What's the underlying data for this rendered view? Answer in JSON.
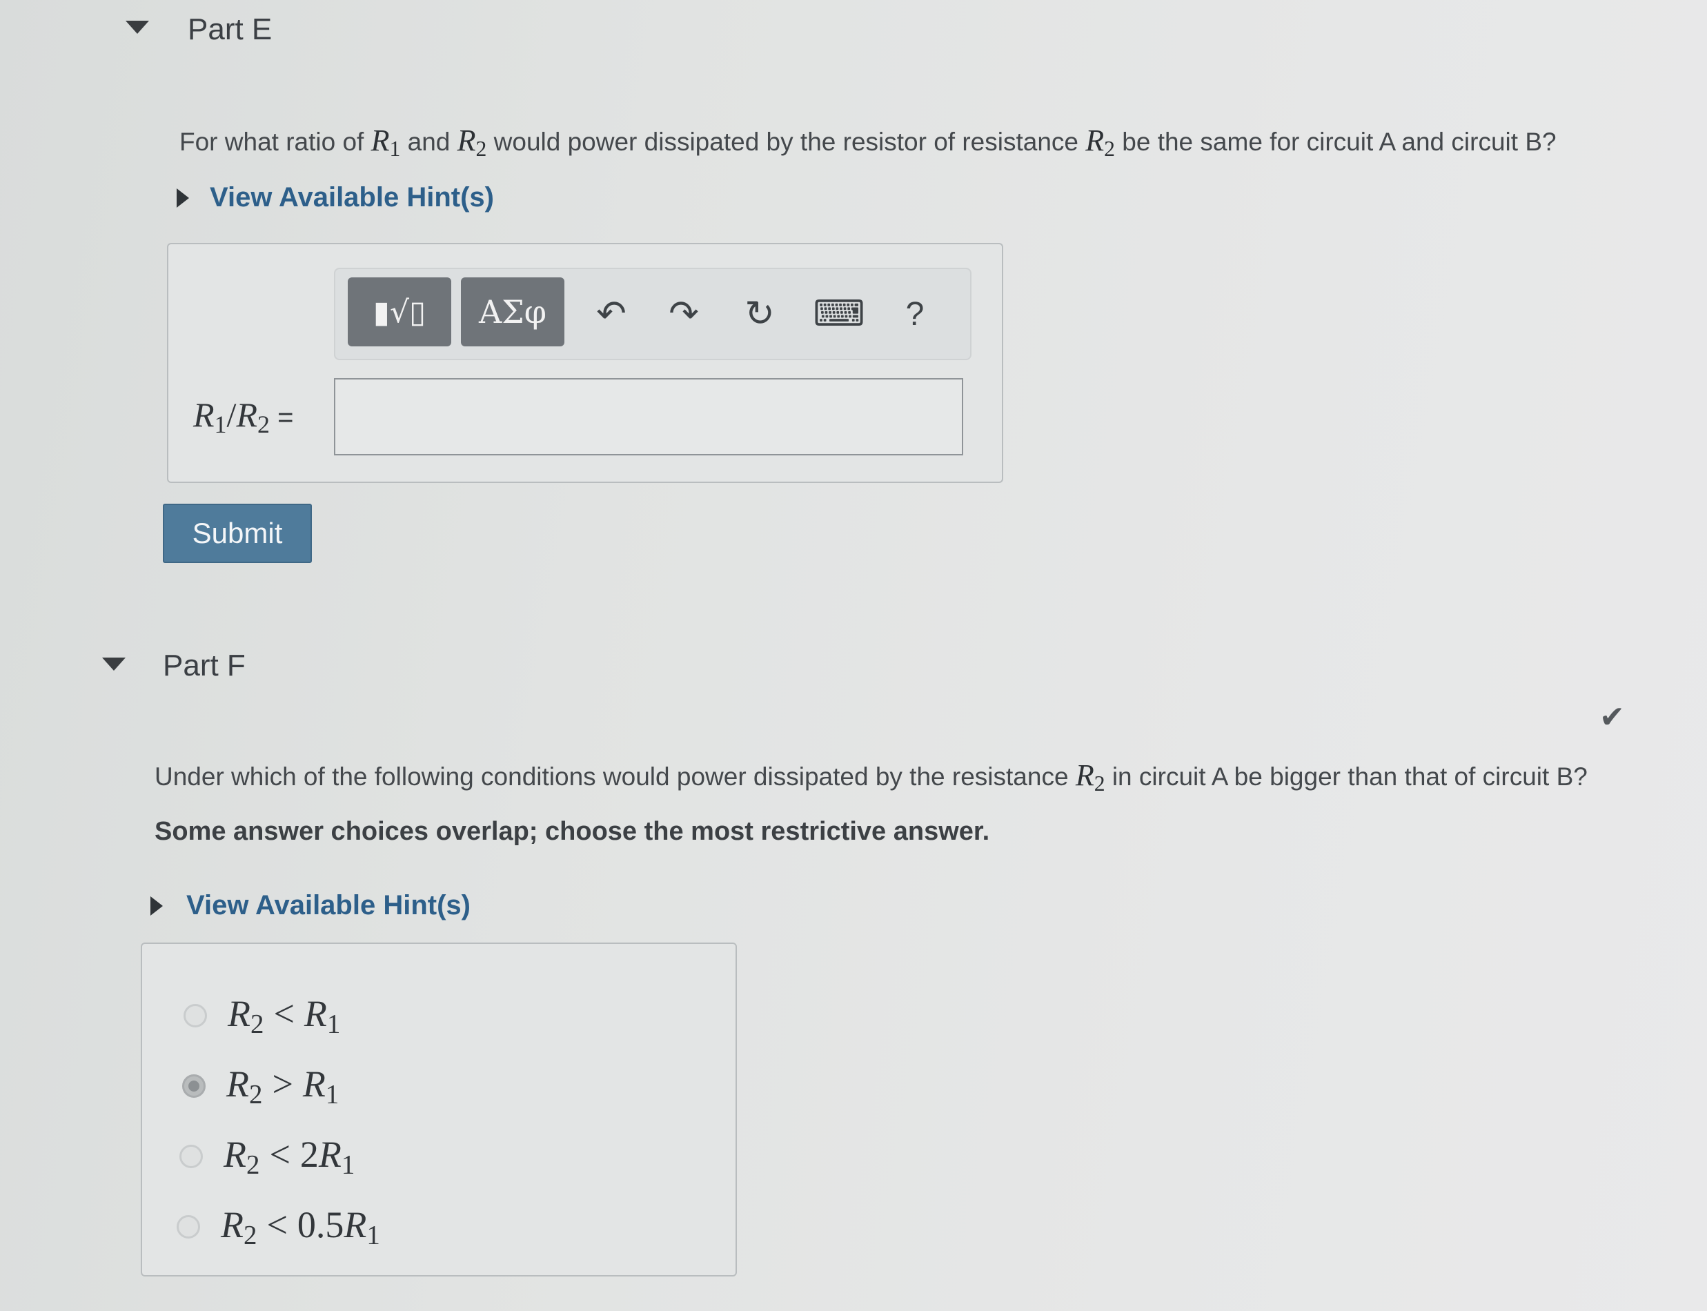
{
  "part_e": {
    "title": "Part E",
    "question_before_r1": "For what ratio of ",
    "r1": {
      "base": "R",
      "sub": "1"
    },
    "and_text": " and ",
    "r2": {
      "base": "R",
      "sub": "2"
    },
    "question_mid": " would power dissipated by the resistor of resistance ",
    "question_end": " be the same for circuit A and circuit B?",
    "hint_label": "View Available Hint(s)",
    "toolbar": {
      "templates_label": "▮√▯",
      "greek_label": "ΑΣφ",
      "undo_icon": "↶",
      "redo_icon": "↷",
      "reset_icon": "↻",
      "keyboard_icon": "⌨",
      "help_label": "?"
    },
    "answer_label": {
      "r1_base": "R",
      "r1_sub": "1",
      "slash": "/",
      "r2_base": "R",
      "r2_sub": "2",
      "equals": " ="
    },
    "answer_value": "",
    "submit_label": "Submit"
  },
  "part_f": {
    "title": "Part F",
    "check_icon": "✔",
    "question_before": "Under which of the following conditions would power dissipated by the resistance ",
    "r2": {
      "base": "R",
      "sub": "2"
    },
    "question_after": " in circuit A be bigger than that of circuit B?",
    "instruction": "Some answer choices overlap; choose the most restrictive answer.",
    "hint_label": "View Available Hint(s)",
    "options": [
      {
        "lhs_base": "R",
        "lhs_sub": "2",
        "op": "<",
        "coef": "",
        "rhs_base": "R",
        "rhs_sub": "1",
        "selected": false
      },
      {
        "lhs_base": "R",
        "lhs_sub": "2",
        "op": ">",
        "coef": "",
        "rhs_base": "R",
        "rhs_sub": "1",
        "selected": true
      },
      {
        "lhs_base": "R",
        "lhs_sub": "2",
        "op": "<",
        "coef": "2",
        "rhs_base": "R",
        "rhs_sub": "1",
        "selected": false
      },
      {
        "lhs_base": "R",
        "lhs_sub": "2",
        "op": "<",
        "coef": "0.5",
        "rhs_base": "R",
        "rhs_sub": "1",
        "selected": false
      }
    ]
  }
}
